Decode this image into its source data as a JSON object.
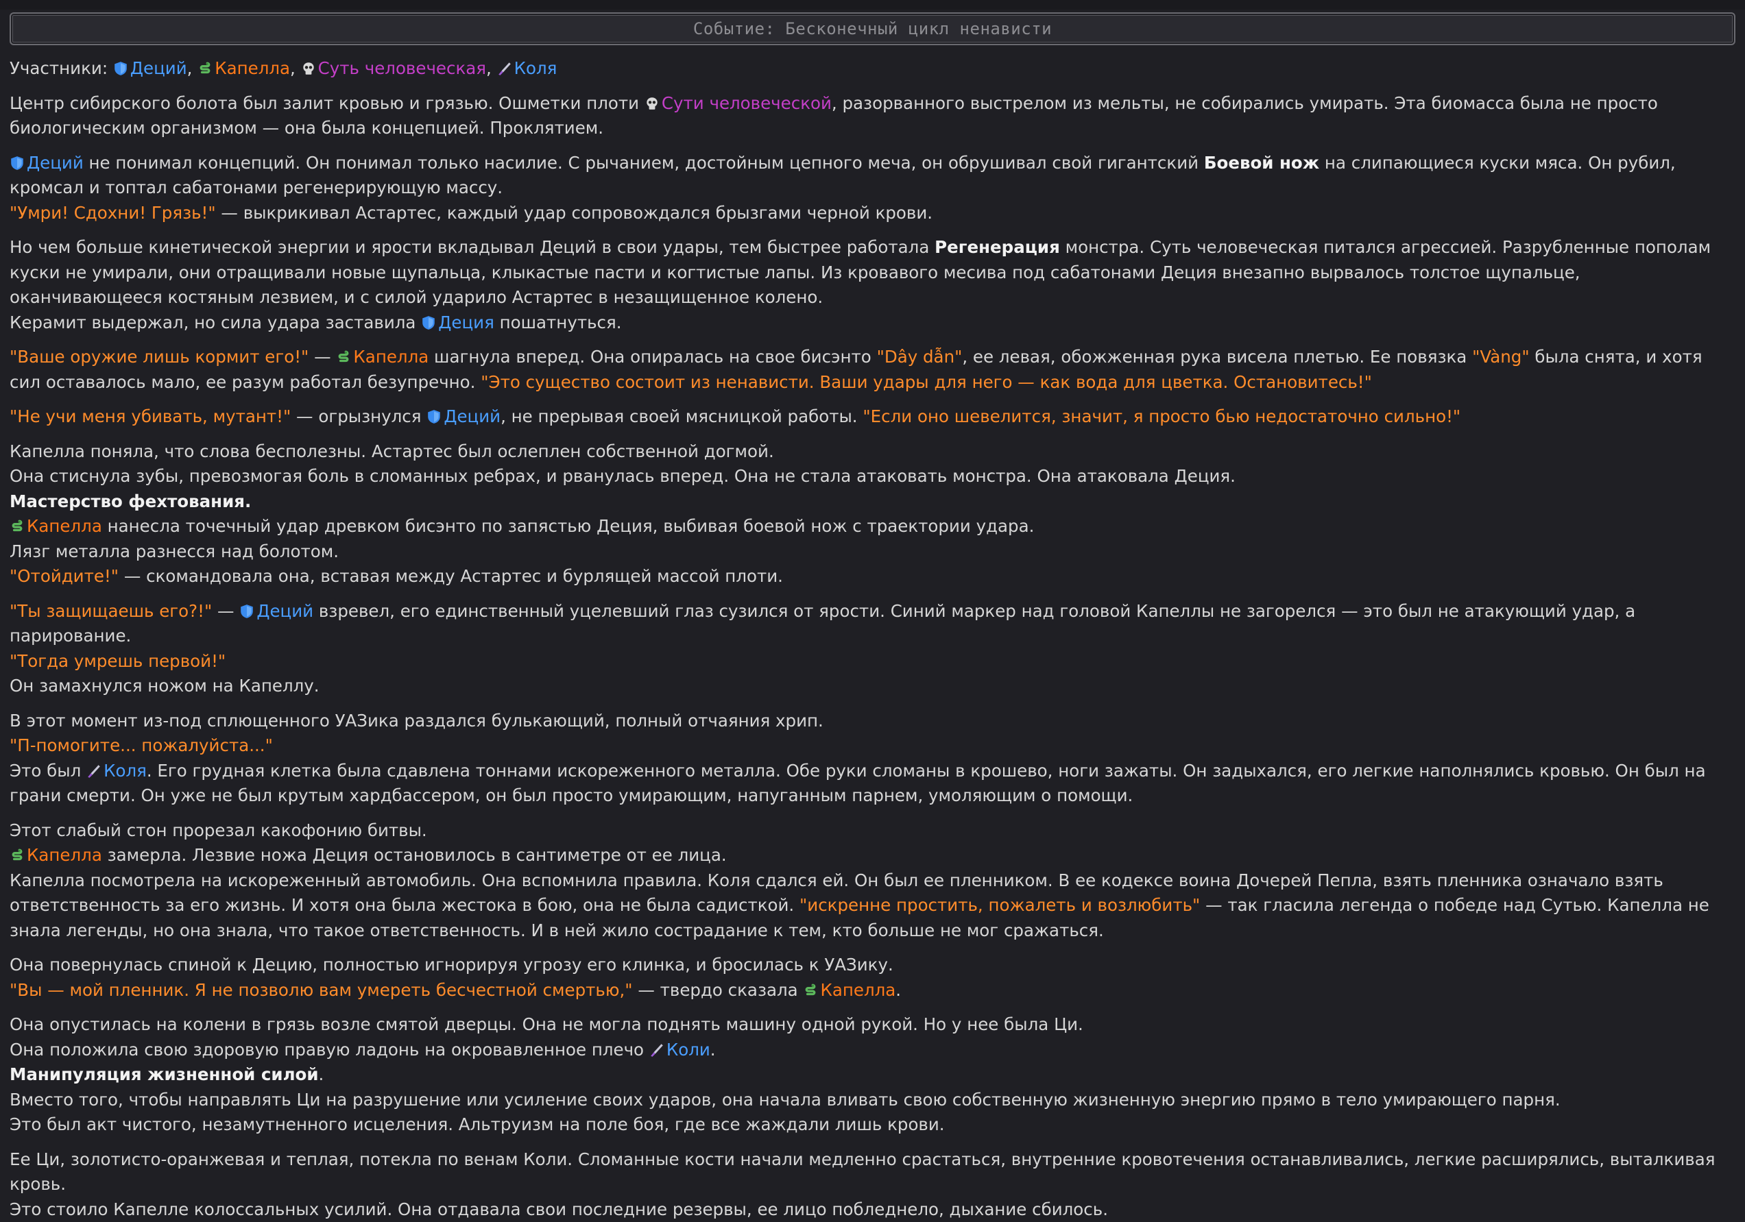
{
  "event": {
    "title": "Событие: Бесконечный цикл ненависти"
  },
  "participants_label": "Участники:",
  "names": {
    "decius": "Деций",
    "kapella": "Капелла",
    "sut": "Суть человеческая",
    "kolya": "Коля",
    "suti": "Сути человеческой",
    "decia": "Деция",
    "kolya_gen": "Коли"
  },
  "icons": {
    "decius": "shield-icon",
    "kapella": "snake-icon",
    "sut": "skull-icon",
    "kolya": "knife-icon"
  },
  "p1": {
    "t1": "Центр сибирского болота был залит кровью и грязью. Ошметки плоти ",
    "t2": ", разорванного выстрелом из мельты, не собирались умирать. Эта биомасса была не просто биологическим организмом — она была концепцией. Проклятием."
  },
  "p2": {
    "t1": " не понимал концепций. Он понимал только насилие. С рычанием, достойным цепного меча, он обрушивал свой гигантский ",
    "b1": "Боевой нож",
    "t2": " на слипающиеся куски мяса. Он рубил, кромсал и топтал сабатонами регенерирующую массу.",
    "q1": "\"Умри! Сдохни! Грязь!\"",
    "t3": " — выкрикивал Астартес, каждый удар сопровождался брызгами черной крови."
  },
  "p3": {
    "t1": "Но чем больше кинетической энергии и ярости вкладывал Деций в свои удары, тем быстрее работала ",
    "b1": "Регенерация",
    "t2": " монстра. Суть человеческая питался агрессией. Разрубленные пополам куски не умирали, они отращивали новые щупальца, клыкастые пасти и когтистые лапы. Из кровавого месива под сабатонами Деция внезапно вырвалось толстое щупальце, оканчивающееся костяным лезвием, и с силой ударило Астартес в незащищенное колено.",
    "t3": "Керамит выдержал, но сила удара заставила ",
    "t4": " пошатнуться."
  },
  "p4": {
    "q1": "\"Ваше оружие лишь кормит его!\"",
    "t1": " — ",
    "t2": " шагнула вперед. Она опиралась на свое бисэнто ",
    "q2": "\"Dây dẫn\"",
    "t3": ", ее левая, обожженная рука висела плетью. Ее повязка ",
    "q3": "\"Vàng\"",
    "t4": " была снята, и хотя сил оставалось мало, ее разум работал безупречно. ",
    "q4": "\"Это существо состоит из ненависти. Ваши удары для него — как вода для цветка. Остановитесь!\""
  },
  "p5": {
    "q1": "\"Не учи меня убивать, мутант!\"",
    "t1": " — огрызнулся ",
    "t2": ", не прерывая своей мясницкой работы. ",
    "q2": "\"Если оно шевелится, значит, я просто бью недостаточно сильно!\""
  },
  "p6": {
    "l1": "Капелла поняла, что слова бесполезны. Астартес был ослеплен собственной догмой.",
    "l2": "Она стиснула зубы, превозмогая боль в сломанных ребрах, и рванулась вперед. Она не стала атаковать монстра. Она атаковала Деция.",
    "b1": "Мастерство фехтования.",
    "t1": " нанесла точечный удар древком бисэнто по запястью Деция, выбивая боевой нож с траектории удара.",
    "l3": "Лязг металла разнесся над болотом.",
    "q1": "\"Отойдите!\"",
    "t2": " — скомандовала она, вставая между Астартес и бурлящей массой плоти."
  },
  "p7": {
    "q1": "\"Ты защищаешь его?!\"",
    "t1": " — ",
    "t2": " взревел, его единственный уцелевший глаз сузился от ярости. Синий маркер над головой Капеллы не загорелся — это был не атакующий удар, а парирование.",
    "q2": "\"Тогда умрешь первой!\"",
    "l1": "Он замахнулся ножом на Капеллу."
  },
  "p8": {
    "l1": "В этот момент из-под сплющенного УАЗика раздался булькающий, полный отчаяния хрип.",
    "q1": "\"П-помогите... пожалуйста...\"",
    "t1": "Это был ",
    "t2": ". Его грудная клетка была сдавлена тоннами искореженного металла. Обе руки сломаны в крошево, ноги зажаты. Он задыхался, его легкие наполнялись кровью. Он был на грани смерти. Он уже не был крутым хардбассером, он был просто умирающим, напуганным парнем, умоляющим о помощи."
  },
  "p9": {
    "l1": "Этот слабый стон прорезал какофонию битвы.",
    "t1": " замерла. Лезвие ножа Деция остановилось в сантиметре от ее лица.",
    "t2": "Капелла посмотрела на искореженный автомобиль. Она вспомнила правила. Коля сдался ей. Он был ее пленником. В ее кодексе воина Дочерей Пепла, взять пленника означало взять ответственность за его жизнь. И хотя она была жестока в бою, она не была садисткой. ",
    "q1": "\"искренне простить, пожалеть и возлюбить\"",
    "t3": " — так гласила легенда о победе над Сутью. Капелла не знала легенды, но она знала, что такое ответственность. И в ней жило сострадание к тем, кто больше не мог сражаться."
  },
  "p10": {
    "l1": "Она повернулась спиной к Децию, полностью игнорируя угрозу его клинка, и бросилась к УАЗику.",
    "q1": "\"Вы — мой пленник. Я не позволю вам умереть бесчестной смертью,\"",
    "t1": " — твердо сказала ",
    "t2": "."
  },
  "p11": {
    "l1": "Она опустилась на колени в грязь возле смятой дверцы. Она не могла поднять машину одной рукой. Но у нее была Ци.",
    "t1": "Она положила свою здоровую правую ладонь на окровавленное плечо ",
    "t2": ".",
    "b1": "Манипуляция жизненной силой",
    "t3": ".",
    "l2": "Вместо того, чтобы направлять Ци на разрушение или усиление своих ударов, она начала вливать свою собственную жизненную энергию прямо в тело умирающего парня.",
    "l3": "Это был акт чистого, незамутненного исцеления. Альтруизм на поле боя, где все жаждали лишь крови."
  },
  "p12": {
    "l1": "Ее Ци, золотисто-оранжевая и теплая, потекла по венам Коли. Сломанные кости начали медленно срастаться, внутренние кровотечения останавливались, легкие расширялись, выталкивая кровь.",
    "l2": "Это стоило Капелле колоссальных усилий. Она отдавала свои последние резервы, ее лицо побледнело, дыхание сбилось."
  }
}
